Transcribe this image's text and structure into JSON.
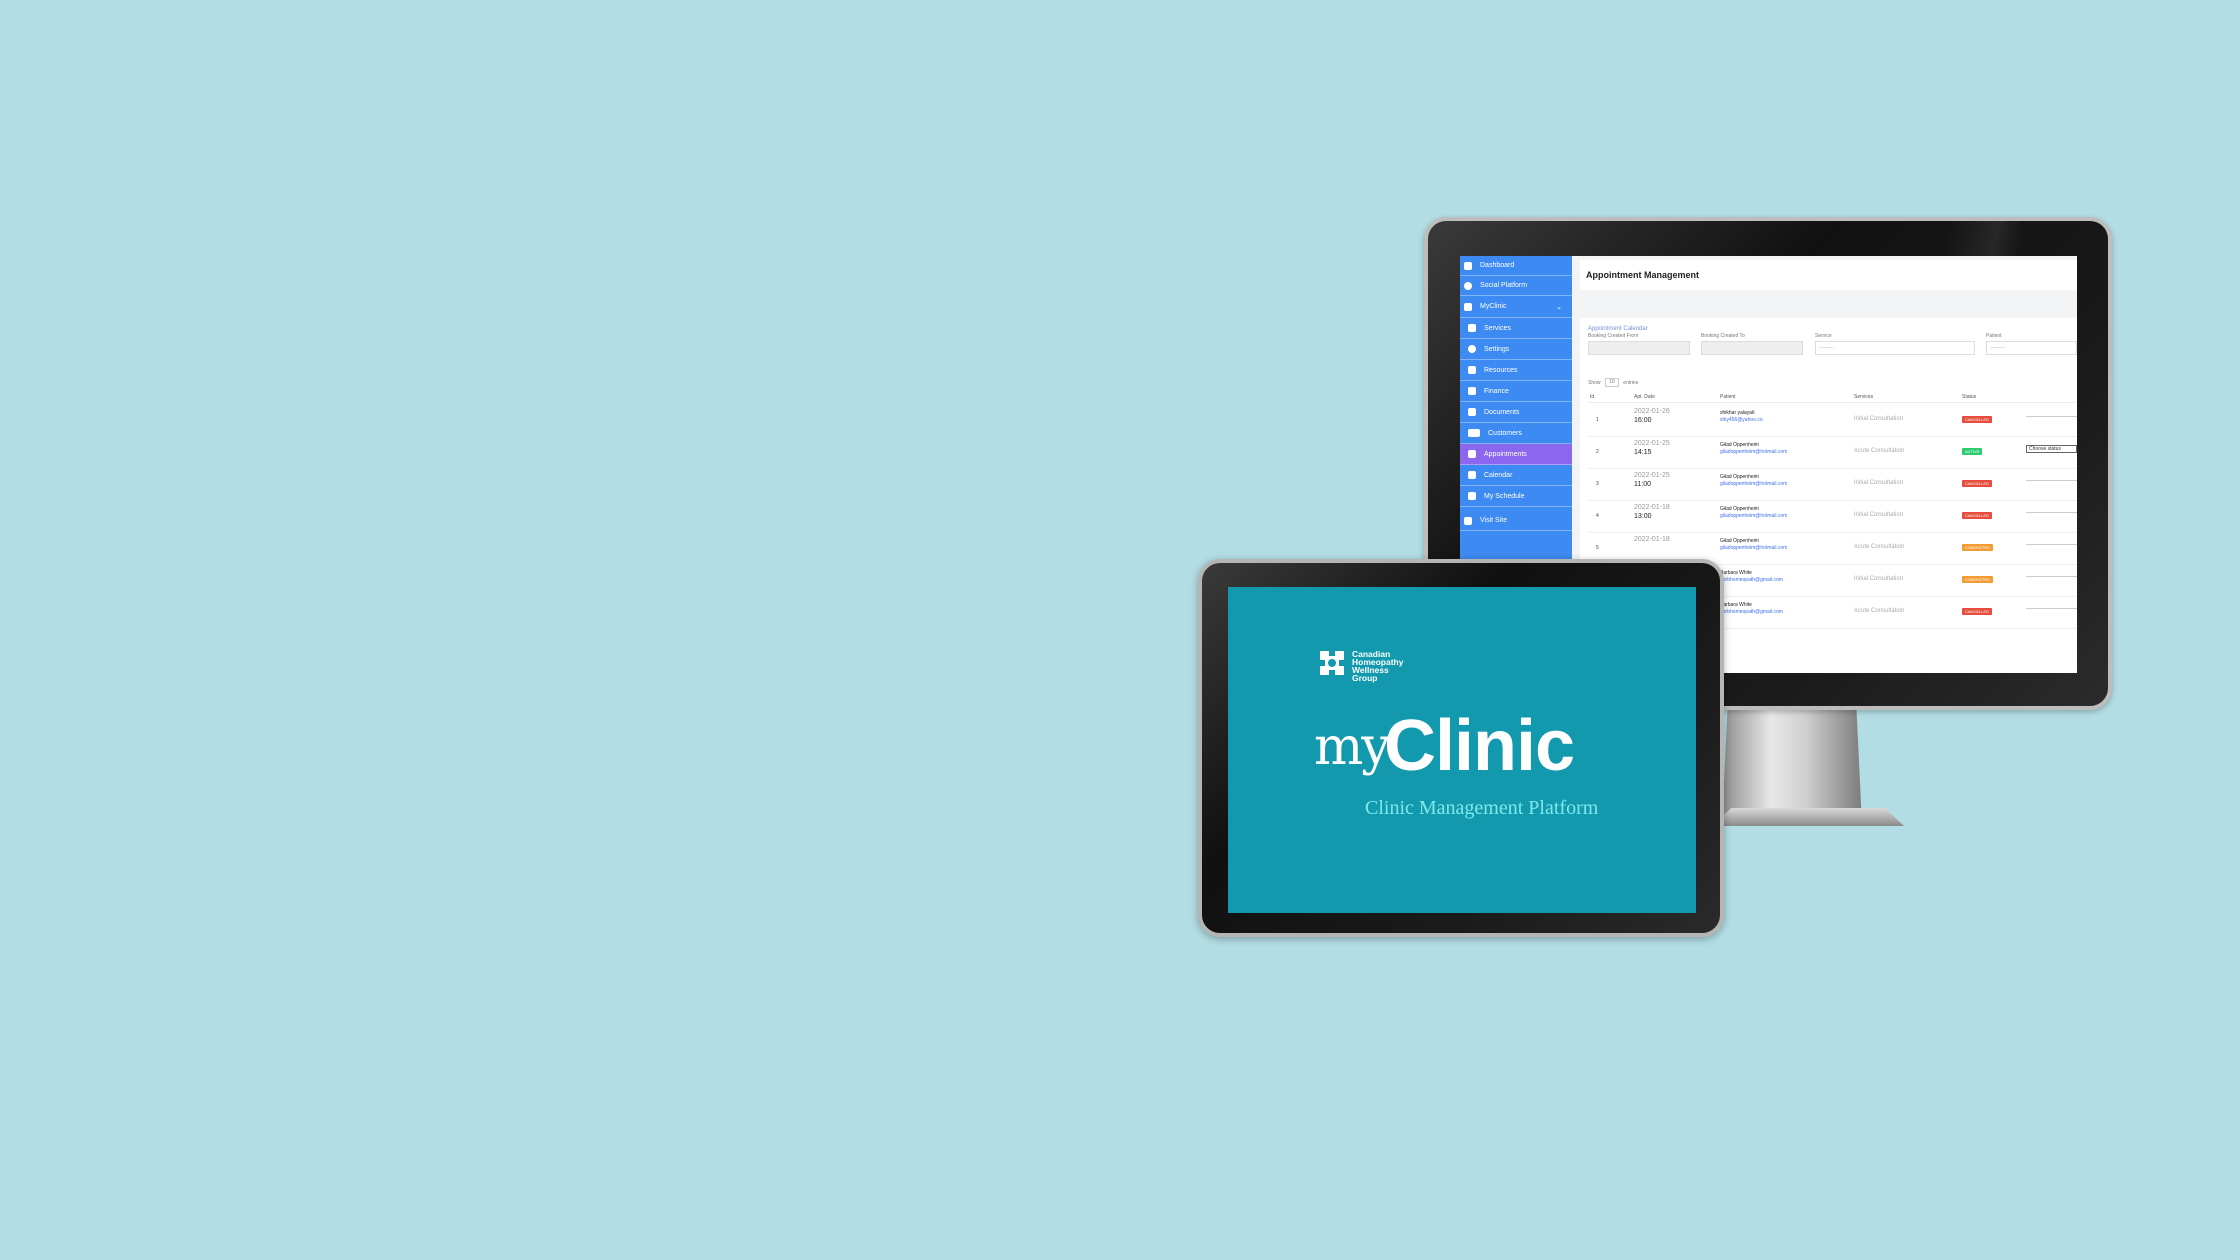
{
  "colors": {
    "background": "#b2dde4",
    "sidebar": "#3d8bf2",
    "sidebar_active": "#8b67f0",
    "tablet_screen": "#1299ad",
    "tagline": "#7fe8ea",
    "cancelled": "#e74c3c",
    "active": "#2ecc71",
    "completed": "#f39c33"
  },
  "sidebar": {
    "items": [
      {
        "label": "Dashboard",
        "icon": "dashboard-icon"
      },
      {
        "label": "Social Platform",
        "icon": "globe-icon"
      },
      {
        "label": "MyClinic",
        "icon": "clinic-icon"
      },
      {
        "label": "Services",
        "icon": "list-icon"
      },
      {
        "label": "Settings",
        "icon": "gear-icon"
      },
      {
        "label": "Resources",
        "icon": "book-icon"
      },
      {
        "label": "Finance",
        "icon": "finance-icon"
      },
      {
        "label": "Documents",
        "icon": "folder-icon"
      },
      {
        "label": "Customers",
        "icon": "users-icon"
      },
      {
        "label": "Appointments",
        "icon": "calendar-check-icon"
      },
      {
        "label": "Calendar",
        "icon": "calendar-icon"
      },
      {
        "label": "My Schedule",
        "icon": "schedule-icon"
      },
      {
        "label": "Visit Site",
        "icon": "home-icon"
      }
    ]
  },
  "header": {
    "title": "Appointment Management"
  },
  "filters": {
    "section_label": "Appointment Calendar",
    "booking_from_label": "Booking Created From",
    "booking_to_label": "Booking Created To",
    "service_label": "Service",
    "service_value": "---------",
    "patient_label": "Patient",
    "patient_value": "---------"
  },
  "table": {
    "show_label": "Show",
    "show_value": "10",
    "entries_label": "entries",
    "columns": [
      "Id",
      "Apt. Date",
      "Patient",
      "Services",
      "Status"
    ],
    "rows": [
      {
        "id": "1",
        "date": "2022-01-26",
        "time": "16:00",
        "patient": "shikhar yalayati",
        "email": "shiy456@yahoo.co",
        "service": "Initial Consultation",
        "status": "CANCELLED",
        "status_color": "#e74c3c"
      },
      {
        "id": "2",
        "date": "2022-01-25",
        "time": "14:15",
        "patient": "Gilad Oppenheim",
        "email": "giladoppenheim@hotmail.com",
        "service": "Acute Consultation",
        "status": "ACTIVE",
        "status_color": "#2ecc71",
        "action": "Choose status"
      },
      {
        "id": "3",
        "date": "2022-01-25",
        "time": "11:00",
        "patient": "Gilad Oppenheim",
        "email": "giladoppenheim@hotmail.com",
        "service": "Initial Consultation",
        "status": "CANCELLED",
        "status_color": "#e74c3c"
      },
      {
        "id": "4",
        "date": "2022-01-18",
        "time": "13:00",
        "patient": "Gilad Oppenheim",
        "email": "giladoppenheim@hotmail.com",
        "service": "Initial Consultation",
        "status": "CANCELLED",
        "status_color": "#e74c3c"
      },
      {
        "id": "5",
        "date": "2022-01-18",
        "time": "",
        "patient": "Gilad Oppenheim",
        "email": "giladoppenheim@hotmail.com",
        "service": "Acute Consultation",
        "status": "COMPLETED",
        "status_color": "#f39c33"
      },
      {
        "id": "",
        "date": "",
        "time": "",
        "patient": "Barbara White",
        "email": "barbhomeopath@gmail.com",
        "service": "Initial Consultation",
        "status": "COMPLETED",
        "status_color": "#f39c33"
      },
      {
        "id": "",
        "date": "",
        "time": "",
        "patient": "Barbara White",
        "email": "barbhomeopath@gmail.com",
        "service": "Acute Consultation",
        "status": "CANCELLED",
        "status_color": "#e74c3c"
      }
    ]
  },
  "tablet": {
    "brand_line1": "Canadian",
    "brand_line2": "Homeopathy",
    "brand_line3": "Wellness",
    "brand_line4": "Group",
    "logo_my": "my",
    "logo_clinic": "Clinic",
    "tagline": "Clinic Management Platform"
  }
}
